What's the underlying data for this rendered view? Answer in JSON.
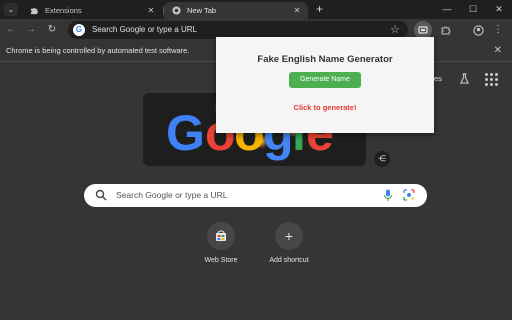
{
  "tabs": [
    {
      "title": "Extensions",
      "active": false
    },
    {
      "title": "New Tab",
      "active": true
    }
  ],
  "window_controls": {
    "minimize": "—",
    "maximize": "☐",
    "close": "✕"
  },
  "toolbar": {
    "omnibox_text": "Search Google or type a URL"
  },
  "infobar": {
    "message": "Chrome is being controlled by automated test software."
  },
  "ntp": {
    "partial_link": "es",
    "search_placeholder": "Search Google or type a URL",
    "shortcuts": [
      {
        "label": "Web Store",
        "icon": "web-store-icon"
      },
      {
        "label": "Add shortcut",
        "icon": "plus-icon"
      }
    ]
  },
  "popup": {
    "title": "Fake English Name Generator",
    "button_label": "Generate Name",
    "status_text": "Click to generate!",
    "accent_color": "#4caf50",
    "status_color": "#e53935"
  }
}
